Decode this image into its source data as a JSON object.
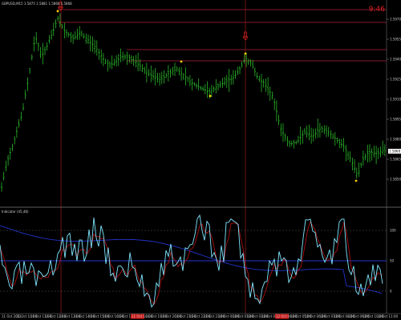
{
  "header": {
    "symbol_line": "GBPUSD,M15  1.5875 1.5881 1.5866 1.5868",
    "countdown": "9:46"
  },
  "indicator": {
    "title": "Indicator (45,48)"
  },
  "current_price_badge": "1.5868",
  "price_axis": [
    "1.5970",
    "1.5955",
    "1.5940",
    "1.5925",
    "1.5910",
    "1.5895",
    "1.5880",
    "1.5865",
    "1.5850"
  ],
  "osc_axis": [
    "100",
    "50",
    "0"
  ],
  "time_axis": [
    "11 Oct 2011",
    "11 Oct 10:00",
    "11 Oct 11:00",
    "11 Oct 12:00",
    "11 Oct 13:00",
    "11 Oct 14:00",
    "11 Oct 15:00",
    "11 Oct 16:00",
    "11 Oct 17:00",
    "11 Oct 18:00",
    "11 Oct 19:00",
    "11 Oct 20:00",
    "11 Oct 21:00",
    "11 Oct 22:00",
    "11 Oct 23:00",
    "12 Oct 00:00",
    "12 Oct 01:00",
    "12 Oct 02:00",
    "12 Oct 03:00",
    "12 Oct 04:00",
    "12 Oct 05:00",
    "12 Oct 06:00",
    "12 Oct 07:00",
    "12 Oct 08:00",
    "12 Oct 09:00",
    "12 Oct 10:00",
    "12 Oct 11:00"
  ],
  "highlighted_times": [
    "11 Oct 18:00",
    "12 Oct 04:00"
  ],
  "colors": {
    "bars": "#2fd12f",
    "resistance": "#b0233b",
    "arrow": "#e02020",
    "osc_main": "#7fe7ff",
    "osc_blue": "#2233cc",
    "osc_red": "#aa1111",
    "fractal": "#ffd400"
  }
}
